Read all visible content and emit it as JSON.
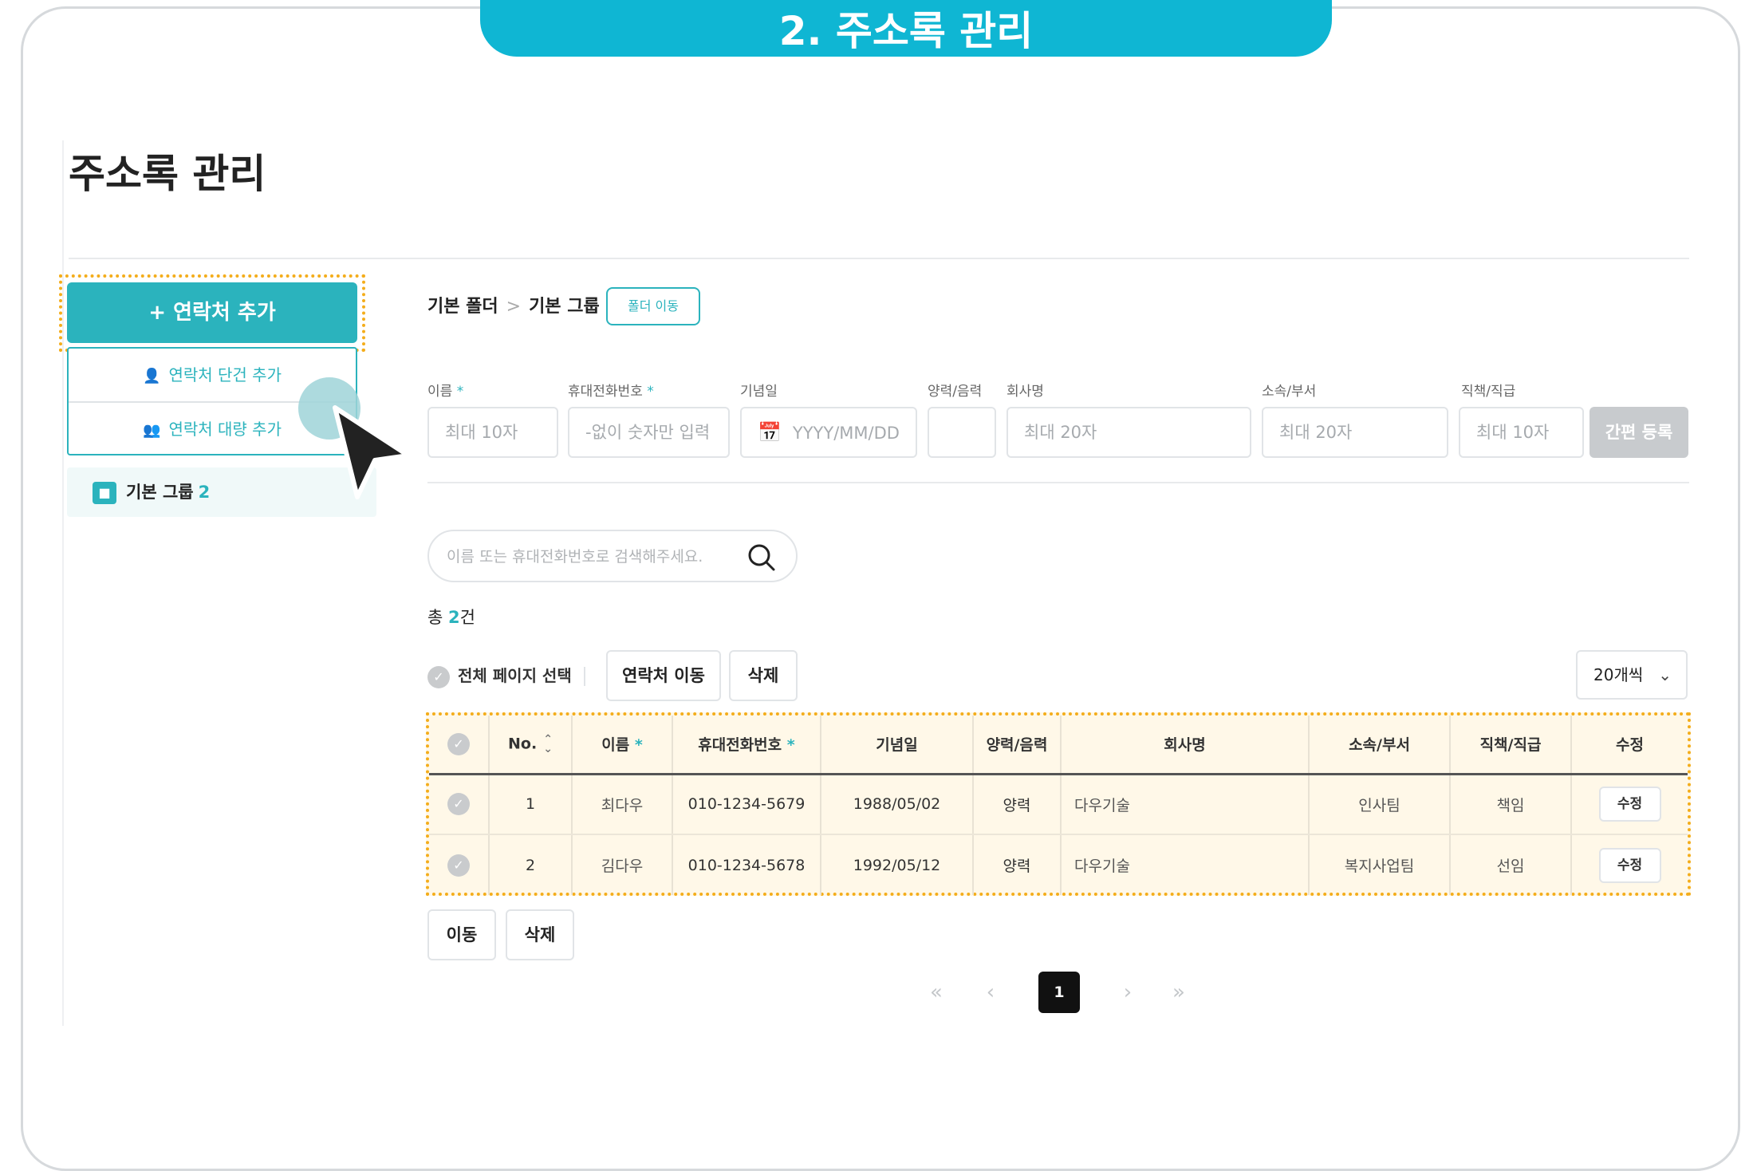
{
  "banner": {
    "title": "2. 주소록 관리"
  },
  "page": {
    "title": "주소록 관리"
  },
  "sidebar": {
    "add_button": "+ 연락처 추가",
    "menu": [
      {
        "label": "연락처 단건 추가",
        "icon": "person-icon"
      },
      {
        "label": "연락처 대량 추가",
        "icon": "people-icon"
      }
    ],
    "group": {
      "label": "기본 그룹",
      "count": "2",
      "icon": "contact-card-icon"
    }
  },
  "breadcrumb": {
    "folder": "기본 폴더",
    "group": "기본 그룹",
    "move_button": "폴더 이동"
  },
  "quick_form": {
    "name": {
      "label": "이름",
      "placeholder": "최대 10자"
    },
    "phone": {
      "label": "휴대전화번호",
      "placeholder": "-없이 숫자만 입력"
    },
    "anniversary": {
      "label": "기념일",
      "placeholder": "YYYY/MM/DD"
    },
    "calendar": {
      "label": "양력/음력",
      "value": ""
    },
    "company": {
      "label": "회사명",
      "placeholder": "최대 20자"
    },
    "department": {
      "label": "소속/부서",
      "placeholder": "최대 20자"
    },
    "position": {
      "label": "직책/직급",
      "placeholder": "최대 10자"
    },
    "required_mark": "*",
    "submit": "간편 등록"
  },
  "search": {
    "placeholder": "이름 또는 휴대전화번호로 검색해주세요.",
    "value": ""
  },
  "summary": {
    "prefix": "총",
    "count": "2",
    "suffix": "건"
  },
  "toolbar": {
    "select_all": "전체 페이지 선택",
    "move": "연락처 이동",
    "delete": "삭제",
    "per_page": "20개씩"
  },
  "table": {
    "headers": {
      "no": "No.",
      "name": "이름",
      "phone": "휴대전화번호",
      "anniversary": "기념일",
      "calendar": "양력/음력",
      "company": "회사명",
      "department": "소속/부서",
      "position": "직책/직급",
      "edit": "수정"
    },
    "rows": [
      {
        "no": "1",
        "name": "최다우",
        "phone": "010-1234-5679",
        "anniversary": "1988/05/02",
        "calendar": "양력",
        "company": "다우기술",
        "department": "인사팀",
        "position": "책임",
        "edit": "수정"
      },
      {
        "no": "2",
        "name": "김다우",
        "phone": "010-1234-5678",
        "anniversary": "1992/05/12",
        "calendar": "양력",
        "company": "다우기술",
        "department": "복지사업팀",
        "position": "선임",
        "edit": "수정"
      }
    ]
  },
  "bottom_actions": {
    "move": "이동",
    "delete": "삭제"
  },
  "pagination": {
    "first": "«",
    "prev": "‹",
    "current": "1",
    "next": "›",
    "last": "»"
  },
  "colors": {
    "accent": "#2bb3bd",
    "banner": "#0fb6d3",
    "highlight_border": "#f4ad1b",
    "highlight_fill": "#fff8e8"
  }
}
